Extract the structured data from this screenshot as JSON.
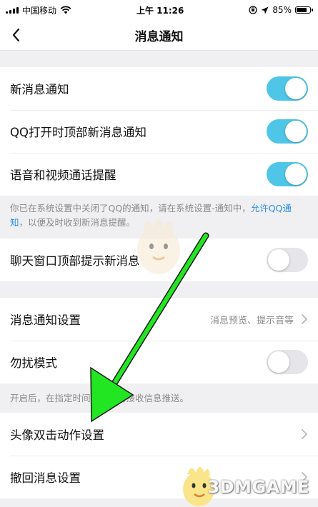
{
  "status_bar": {
    "carrier": "中国移动",
    "time": "上午 11:26",
    "battery": "85%",
    "battery_level": 0.85
  },
  "header": {
    "title": "消息通知"
  },
  "group1": {
    "items": [
      {
        "label": "新消息通知",
        "toggle": "on"
      },
      {
        "label": "QQ打开时顶部新消息通知",
        "toggle": "on"
      },
      {
        "label": "语音和视频通话提醒",
        "toggle": "on"
      }
    ]
  },
  "notice": {
    "text_before": "你已在系统设置中关闭了QQ的通知，请在系统设置-通知中，",
    "link": "允许QQ通知",
    "text_after": "，以便及时收到新消息提醒。"
  },
  "group2": {
    "item": {
      "label": "聊天窗口顶部提示新消息",
      "toggle": "off"
    }
  },
  "group3": {
    "settings": {
      "label": "消息通知设置",
      "value": "消息预览、提示音等"
    },
    "dnd": {
      "label": "勿扰模式",
      "toggle": "off"
    },
    "hint": "开启后，在指定时间内将不再接收信息推送。"
  },
  "group4": {
    "items": [
      {
        "label": "头像双击动作设置"
      },
      {
        "label": "撤回消息设置"
      }
    ]
  },
  "watermark": {
    "text": "3DMGAME"
  },
  "colors": {
    "toggle_on": "#4fc6e8",
    "toggle_off": "#e5e5ea",
    "link": "#2b8ce0",
    "arrow": "#22e622"
  },
  "icons": [
    "wifi-icon",
    "signal-icon",
    "lock-rotation-icon",
    "location-icon",
    "battery-icon",
    "back-arrow-icon",
    "chevron-right-icon",
    "mascot-icon"
  ]
}
